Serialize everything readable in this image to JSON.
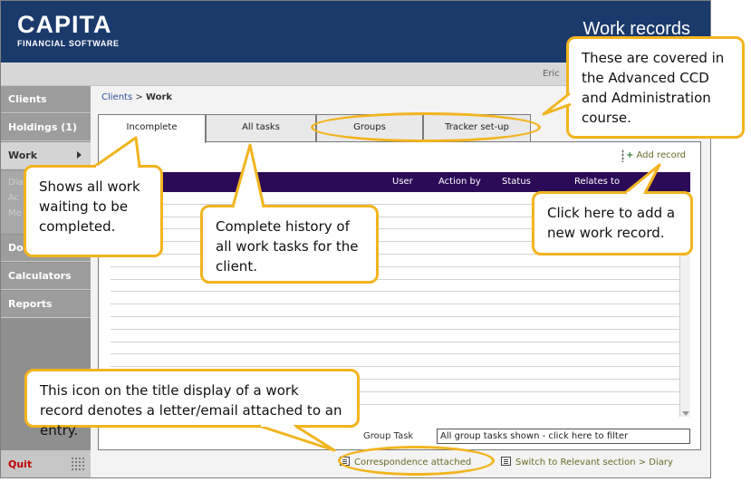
{
  "header": {
    "brand": "CAPITA",
    "brand_sub": "FINANCIAL SOFTWARE",
    "title": "Work records",
    "user": "Eric"
  },
  "sidebar": {
    "items": [
      {
        "label": "Clients"
      },
      {
        "label": "Holdings (1)"
      },
      {
        "label": "Work"
      },
      {
        "label": "Doc"
      },
      {
        "label": "Calculators"
      },
      {
        "label": "Reports"
      }
    ],
    "submenu": [
      "Dia",
      "Ac",
      "Me"
    ],
    "quit": "Quit"
  },
  "breadcrumb": {
    "parent": "Clients",
    "separator": ">",
    "current": "Work"
  },
  "tabs": [
    {
      "label": "Incomplete"
    },
    {
      "label": "All tasks"
    },
    {
      "label": "Groups"
    },
    {
      "label": "Tracker set-up"
    }
  ],
  "toolbar": {
    "add_label": "Add record"
  },
  "table": {
    "columns": [
      "User",
      "Action by",
      "Status",
      "Relates to"
    ]
  },
  "group_task": {
    "label": "Group Task",
    "value": "All group tasks shown - click here to filter"
  },
  "footer": {
    "correspondence": "Correspondence attached",
    "switch": "Switch to Relevant section > Diary"
  },
  "callouts": {
    "advanced": "These are covered in the Advanced CCD and Administration course.",
    "incomplete": "Shows all work waiting to be completed.",
    "history": "Complete history of all work tasks for the client.",
    "add": "Click here to add a new work record.",
    "icon": "This icon on the title display of a work record denotes a letter/email attached to an entry."
  },
  "colors": {
    "header": "#1b3a6c",
    "table_header": "#2b0b57",
    "callout_border": "#f2b41e",
    "quit": "#c00000"
  }
}
